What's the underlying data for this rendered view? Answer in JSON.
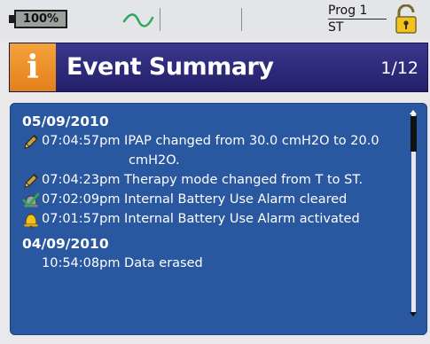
{
  "status": {
    "battery_label": "100%",
    "program_label": "Prog 1",
    "mode_label": "ST",
    "icons": [
      "battery-icon",
      "airflow-wave-icon",
      "padlock-icon"
    ]
  },
  "header": {
    "info_glyph": "i",
    "title": "Event Summary",
    "page": "1/12"
  },
  "events": {
    "day1": {
      "date": "05/09/2010",
      "items": [
        {
          "icon": "pencil-icon",
          "text": "07:04:57pm IPAP changed from 30.0 cmH2O to 20.0",
          "text_cont": "cmH2O."
        },
        {
          "icon": "pencil-icon",
          "text": "07:04:23pm Therapy mode changed from T to ST."
        },
        {
          "icon": "alarm-cleared-icon",
          "text": "07:02:09pm Internal Battery Use Alarm cleared"
        },
        {
          "icon": "alarm-bell-icon",
          "text": "07:01:57pm Internal Battery Use Alarm activated"
        }
      ]
    },
    "day2": {
      "date": "04/09/2010",
      "items": [
        {
          "icon": "none",
          "text": "10:54:08pm Data erased"
        }
      ]
    }
  },
  "colors": {
    "title_bar": "#2e2b7e",
    "accent_orange": "#f0952e",
    "panel_blue": "#2a58a0",
    "status_bg": "#e4e5e9"
  }
}
